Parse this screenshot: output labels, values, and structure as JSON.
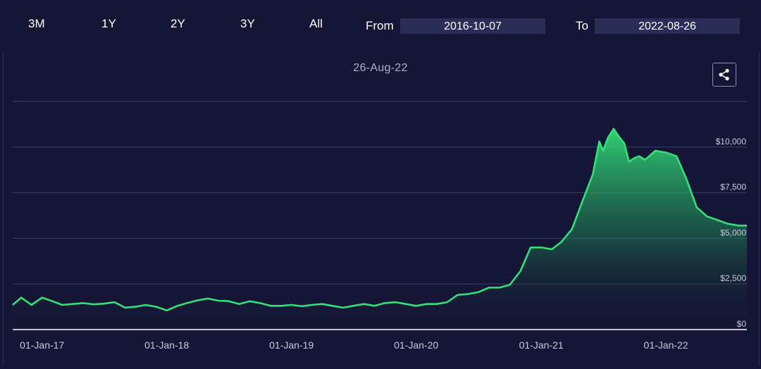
{
  "toolbar": {
    "ranges": [
      "3M",
      "1Y",
      "2Y",
      "3Y",
      "All"
    ],
    "from_label": "From",
    "from_value": "2016-10-07",
    "to_label": "To",
    "to_value": "2022-08-26"
  },
  "share_icon": "share-icon",
  "colors": {
    "background": "#151635",
    "line": "#35e07a",
    "grid": "#3b3e66",
    "axis": "#ffffff"
  },
  "chart_data": {
    "type": "area",
    "title": "26-Aug-22",
    "xlabel": "",
    "ylabel": "",
    "ylim": [
      0,
      12500
    ],
    "y_ticks": [
      0,
      2500,
      5000,
      7500,
      10000
    ],
    "y_tick_labels": [
      "$0",
      "$2,500",
      "$5,000",
      "$7,500",
      "$10,000"
    ],
    "x_ticks": [
      "2017-01-01",
      "2018-01-01",
      "2019-01-01",
      "2020-01-01",
      "2021-01-01",
      "2022-01-01"
    ],
    "x_tick_labels": [
      "01-Jan-17",
      "01-Jan-18",
      "01-Jan-19",
      "01-Jan-20",
      "01-Jan-21",
      "01-Jan-22"
    ],
    "grid": true,
    "series": [
      {
        "x": [
          "2016-10-07",
          "2016-11-01",
          "2016-12-01",
          "2017-01-01",
          "2017-02-01",
          "2017-03-01",
          "2017-04-01",
          "2017-05-01",
          "2017-06-01",
          "2017-07-01",
          "2017-08-01",
          "2017-09-01",
          "2017-10-01",
          "2017-11-01",
          "2017-12-01",
          "2018-01-01",
          "2018-02-01",
          "2018-03-01",
          "2018-04-01",
          "2018-05-01",
          "2018-06-01",
          "2018-07-01",
          "2018-08-01",
          "2018-09-01",
          "2018-10-01",
          "2018-11-01",
          "2018-12-01",
          "2019-01-01",
          "2019-02-01",
          "2019-03-01",
          "2019-04-01",
          "2019-05-01",
          "2019-06-01",
          "2019-07-01",
          "2019-08-01",
          "2019-09-01",
          "2019-10-01",
          "2019-11-01",
          "2019-12-01",
          "2020-01-01",
          "2020-02-01",
          "2020-03-01",
          "2020-04-01",
          "2020-05-01",
          "2020-06-01",
          "2020-07-01",
          "2020-08-01",
          "2020-09-01",
          "2020-10-01",
          "2020-11-01",
          "2020-12-01",
          "2021-01-01",
          "2021-02-01",
          "2021-03-01",
          "2021-04-01",
          "2021-05-01",
          "2021-06-01",
          "2021-06-20",
          "2021-07-01",
          "2021-07-15",
          "2021-08-01",
          "2021-08-15",
          "2021-09-01",
          "2021-09-15",
          "2021-10-01",
          "2021-10-15",
          "2021-11-01",
          "2021-12-01",
          "2022-01-01",
          "2022-02-01",
          "2022-03-01",
          "2022-04-01",
          "2022-05-01",
          "2022-06-01",
          "2022-07-01",
          "2022-08-01",
          "2022-08-26"
        ],
        "values": [
          1350,
          1750,
          1350,
          1750,
          1550,
          1350,
          1400,
          1450,
          1380,
          1420,
          1500,
          1200,
          1250,
          1350,
          1250,
          1050,
          1300,
          1450,
          1600,
          1700,
          1580,
          1560,
          1400,
          1550,
          1450,
          1300,
          1300,
          1350,
          1280,
          1350,
          1400,
          1300,
          1200,
          1300,
          1400,
          1300,
          1450,
          1500,
          1400,
          1300,
          1400,
          1400,
          1500,
          1900,
          1950,
          2050,
          2300,
          2300,
          2450,
          3200,
          4500,
          4500,
          4400,
          4800,
          5500,
          7000,
          8500,
          10300,
          9800,
          10500,
          11000,
          10600,
          10200,
          9200,
          9400,
          9500,
          9300,
          9800,
          9700,
          9500,
          8300,
          6700,
          6200,
          6000,
          5800,
          5700,
          5700
        ]
      }
    ]
  }
}
